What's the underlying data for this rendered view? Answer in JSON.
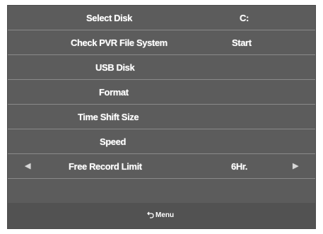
{
  "menu": {
    "rows": [
      {
        "label": "Select Disk",
        "value": "C:"
      },
      {
        "label": "Check PVR File System",
        "value": "Start"
      },
      {
        "label": "USB Disk",
        "value": ""
      },
      {
        "label": "Format",
        "value": ""
      },
      {
        "label": "Time Shift Size",
        "value": ""
      },
      {
        "label": "Speed",
        "value": ""
      },
      {
        "label": "Free Record Limit",
        "value": "6Hr."
      }
    ]
  },
  "footer": {
    "back_label": "Menu",
    "back_icon": "return-arrow-icon"
  },
  "icons": {
    "left_arrow": "arrow-left-icon",
    "right_arrow": "arrow-right-icon"
  }
}
